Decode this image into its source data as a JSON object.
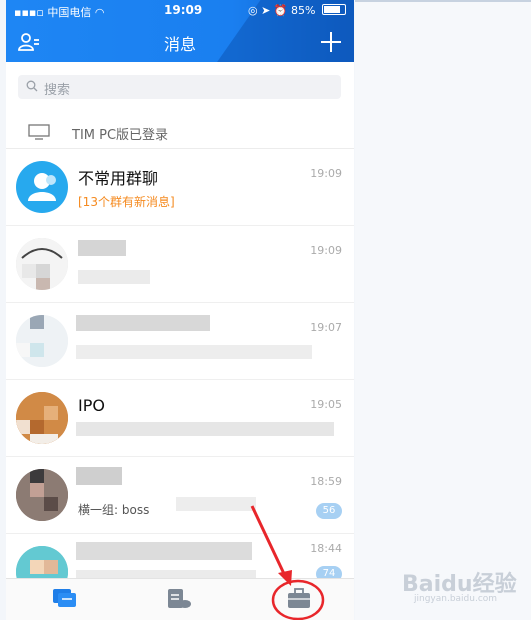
{
  "status_bar": {
    "carrier": "中国电信",
    "time": "19:09",
    "battery": "85%"
  },
  "header": {
    "title": "消息"
  },
  "search": {
    "placeholder": "搜索"
  },
  "device_notice": {
    "text": "TIM PC版已登录"
  },
  "chats": [
    {
      "name": "不常用群聊",
      "preview": "[13个群有新消息]",
      "time": "19:09"
    },
    {
      "name": "",
      "preview": "",
      "time": "19:09"
    },
    {
      "name": "",
      "preview": "",
      "time": "19:07"
    },
    {
      "name": "IPO",
      "preview": "",
      "time": "19:05"
    },
    {
      "name": "",
      "preview": "横一组: boss",
      "time": "18:59",
      "badge": "56"
    },
    {
      "name": "",
      "preview": "",
      "time": "18:44",
      "badge": "74"
    }
  ],
  "tabs": [
    "messages",
    "docs",
    "workbench"
  ],
  "colors": {
    "header_blue": "#1e86f4",
    "notice_orange": "#f58a1f",
    "badge_blue": "#a7d0f3",
    "annotation_red": "#e8262b"
  },
  "watermark": {
    "text": "Baidu经验",
    "sub": "jingyan.baidu.com"
  }
}
